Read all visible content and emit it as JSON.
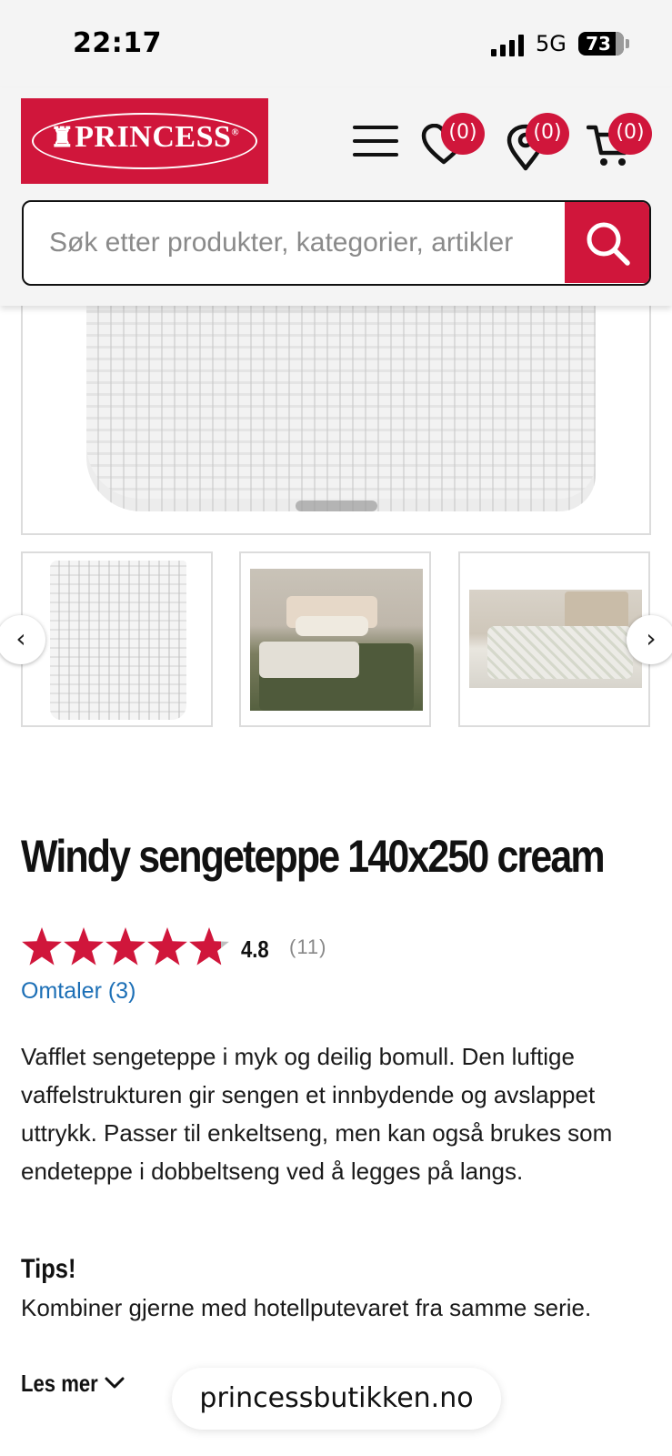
{
  "status_bar": {
    "time": "22:17",
    "network": "5G",
    "battery": "73",
    "battery_level": 0.73
  },
  "header": {
    "brand": "PRINCESS",
    "brand_mark": "®",
    "wishlist_count": "(0)",
    "stores_count": "(0)",
    "cart_count": "(0)",
    "icons": {
      "menu": "hamburger-menu-icon",
      "wishlist": "heart-icon",
      "stores": "location-pin-icon",
      "cart": "shopping-cart-icon",
      "search": "search-icon"
    }
  },
  "search": {
    "placeholder": "Søk etter produkter, kategorier, artikler"
  },
  "gallery": {
    "prev_arrow": "‹",
    "next_arrow": "›"
  },
  "product": {
    "title": "Windy sengeteppe 140x250 cream",
    "rating": {
      "value": "4.8",
      "count": "(11)",
      "stars_filled": 4.8,
      "stars_total": 5
    },
    "reviews_link": "Omtaler (3)",
    "description": "Vafflet sengeteppe i myk og deilig bomull. Den luftige vaffelstrukturen gir sengen et innbydende og avslappet uttrykk. Passer til enkeltseng, men kan også brukes som endeteppe i dobbeltseng ved å legges på langs.",
    "tips_heading": "Tips!",
    "tips_text": "Kombiner gjerne med hotellputevaret fra samme serie.",
    "read_more": "Les mer"
  },
  "browser": {
    "url": "princessbutikken.no"
  },
  "colors": {
    "brand_red": "#d0163b",
    "link_blue": "#1c6fb6",
    "star_empty": "#bdbdbd"
  }
}
